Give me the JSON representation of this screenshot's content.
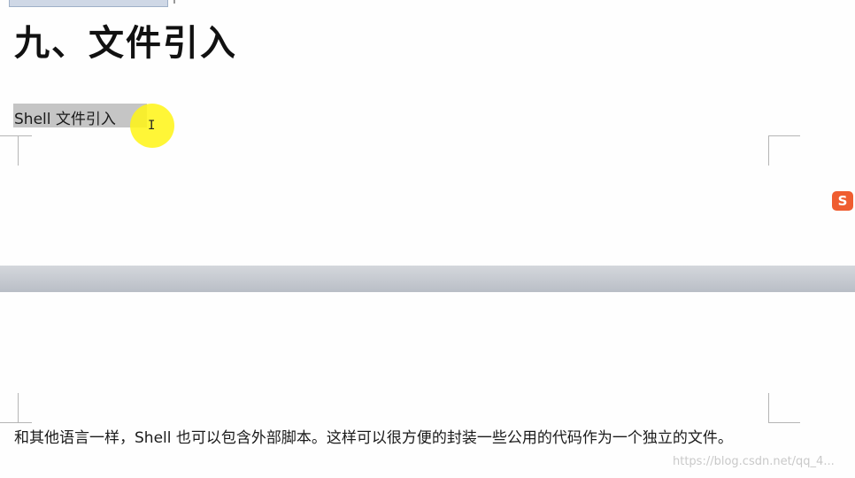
{
  "document": {
    "heading": "九、文件引入",
    "selected_line": "Shell  文件引入",
    "paragraph": "和其他语言一样，Shell 也可以包含外部脚本。这样可以很方便的封装一些公用的代码作为一个独立的文件。"
  },
  "overlay": {
    "ime_icon_letter": "S",
    "ime_icon": "sogou-ime-icon",
    "cursor_icon": "ibeam-cursor-icon",
    "watermark": "https://blog.csdn.net/qq_4..."
  },
  "colors": {
    "selection": "#c5c5c5",
    "cursor_highlight": "#fff514",
    "ime_icon": "#ef5d30"
  }
}
